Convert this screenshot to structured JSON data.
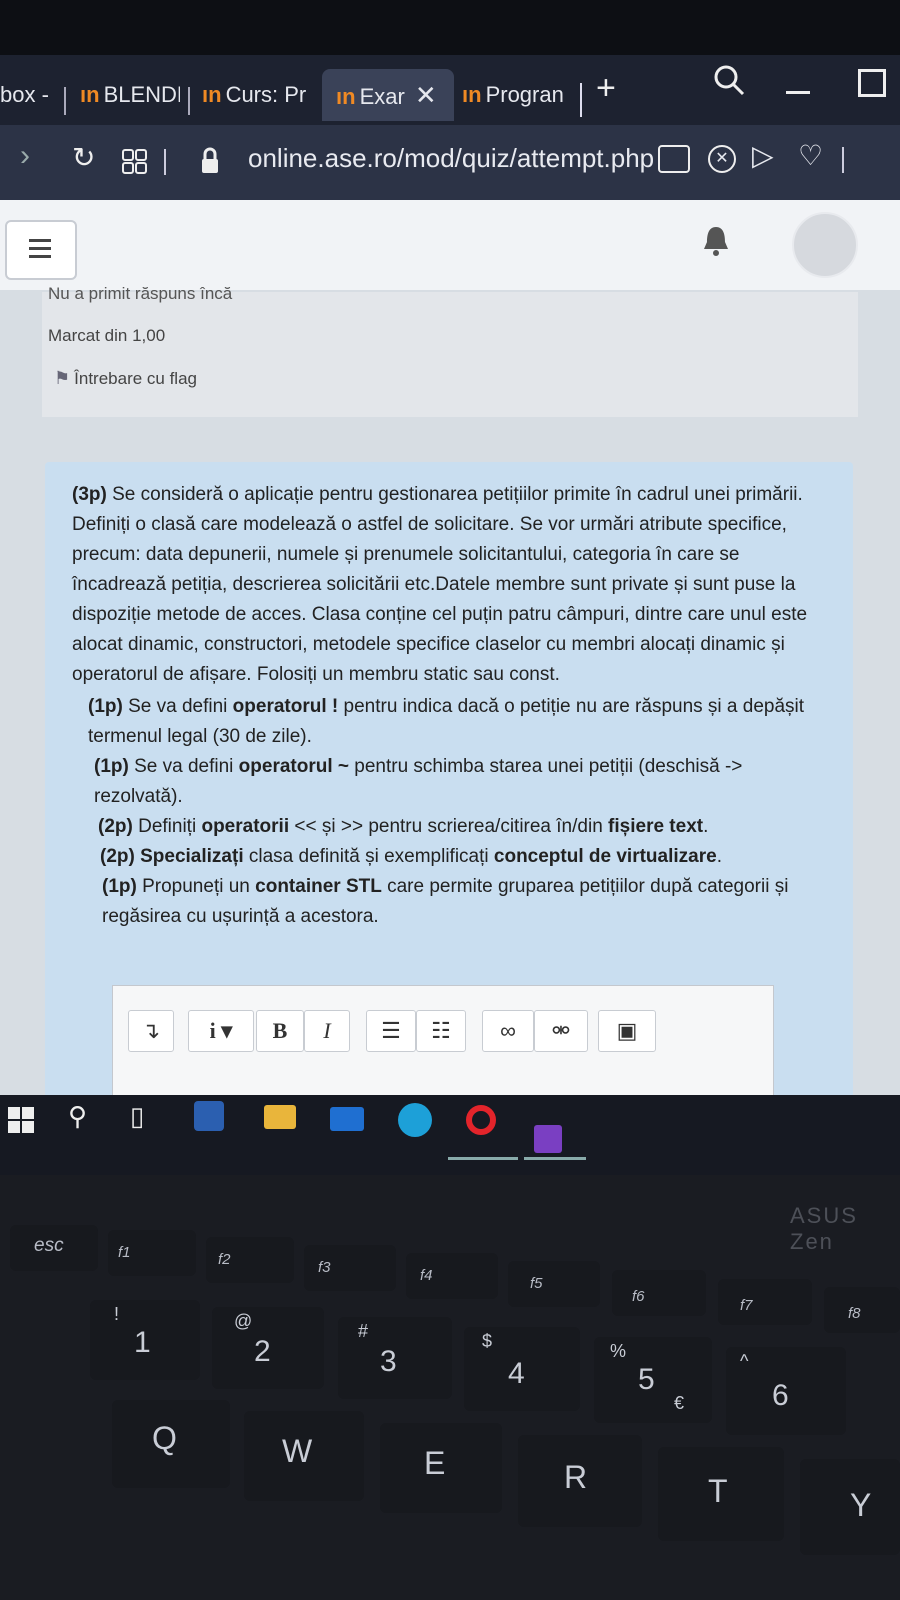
{
  "browser": {
    "tabs": [
      {
        "label": "box -"
      },
      {
        "icon": "ın",
        "label": "BLENDE"
      },
      {
        "icon": "ın",
        "label": "Curs: Pr"
      },
      {
        "icon": "ın",
        "label": "Exar",
        "active": true
      },
      {
        "icon": "ın",
        "label": "Progran"
      }
    ],
    "new_tab": "+",
    "url": "online.ase.ro/mod/quiz/attempt.php"
  },
  "question_info": {
    "status": "Nu a primit răspuns încă",
    "mark": "Marcat din 1,00",
    "flag": "Întrebare cu flag"
  },
  "question": {
    "p1_marks": "(3p)",
    "p1_text": " Se consideră o aplicație pentru gestionarea petițiilor primite în cadrul unei primării. Definiți o clasă care modelează o astfel de solicitare. Se vor urmări atribute specifice, precum: data depunerii, numele și prenumele solicitantului, categoria în care se încadrează petiția, descrierea solicitării etc.Datele membre sunt private și sunt puse la dispoziție metode de acces. Clasa conține cel puțin patru câmpuri, dintre care unul este alocat dinamic, constructori, metodele specifice claselor cu membri alocați dinamic și operatorul de afișare. Folosiți un membru static sau const.",
    "p2_marks": "(1p)",
    "p2_a": " Se va defini ",
    "p2_b": "operatorul !",
    "p2_c": " pentru indica dacă o petiție nu are răspuns și a depășit termenul legal (30 de zile).",
    "p3_marks": "(1p)",
    "p3_a": " Se va defini ",
    "p3_b": "operatorul ~",
    "p3_c": " pentru schimba starea unei petiții (deschisă -> rezolvată).",
    "p4_marks": "(2p)",
    "p4_a": " Definiți ",
    "p4_b": "operatorii",
    "p4_c": " << și >> pentru scrierea/citirea în/din ",
    "p4_d": "fișiere text",
    "p4_e": ".",
    "p5_marks": "(2p)",
    "p5_a": "Specializați",
    "p5_b": " clasa definită și exemplificați ",
    "p5_c": "conceptul de virtualizare",
    "p5_d": ".",
    "p6_marks": "(1p)",
    "p6_a": " Propuneți un ",
    "p6_b": "container STL",
    "p6_c": " care permite gruparea petițiilor după categorii și regăsirea cu ușurință a acestora."
  },
  "editor_toolbar": {
    "collapse": "↴",
    "info": "i ▾",
    "bold": "B",
    "italic": "I"
  },
  "keyboard": {
    "esc": "esc",
    "f1": "f1",
    "f2": "f2",
    "f3": "f3",
    "f4": "f4",
    "f5": "f5",
    "f6": "f6",
    "f7": "f7",
    "f8": "f8",
    "nums": [
      "1",
      "2",
      "3",
      "4",
      "5",
      "6"
    ],
    "syms": [
      "!",
      "@",
      "#",
      "$",
      "%",
      "^"
    ],
    "euro": "€",
    "letters": [
      "Q",
      "W",
      "E",
      "R",
      "T",
      "Y"
    ],
    "brand": "ASUS Zen"
  }
}
